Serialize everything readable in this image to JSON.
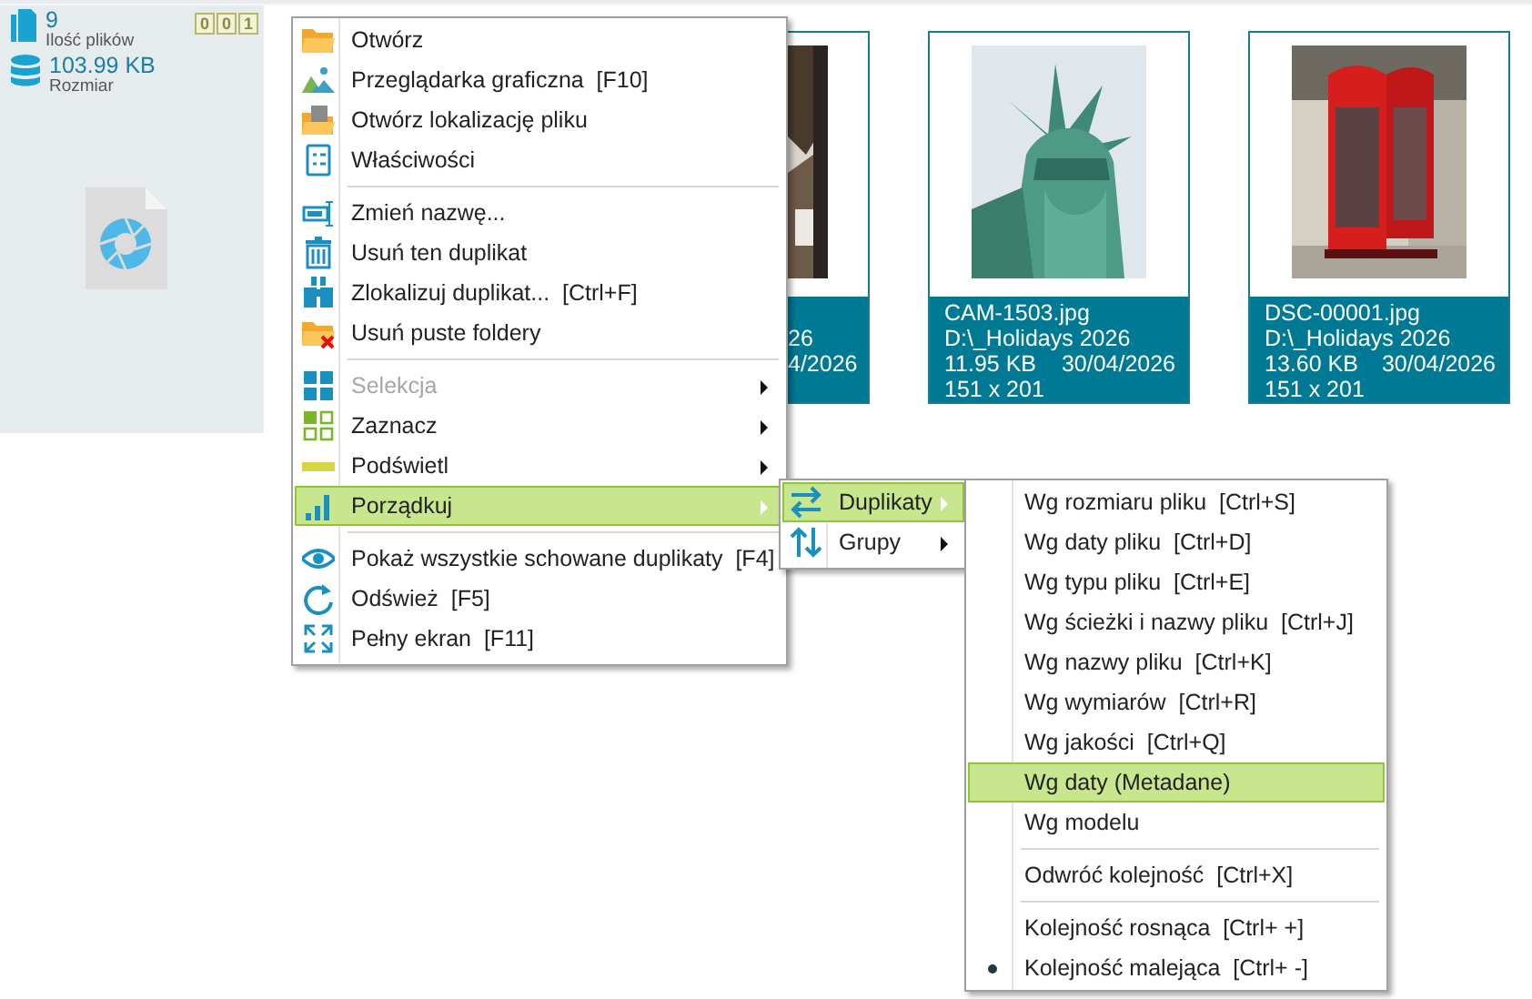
{
  "sidebar": {
    "file_count": "9",
    "file_count_label": "Ilość plików",
    "size": "103.99 KB",
    "size_label": "Rozmiar",
    "counters": [
      "0",
      "0",
      "1"
    ]
  },
  "cards": [
    {
      "kind": "partial",
      "lines": [
        "26",
        "4/2026"
      ]
    },
    {
      "kind": "full",
      "name": "CAM-1503.jpg",
      "path": "D:\\_Holidays 2026",
      "size": "11.95 KB",
      "date": "30/04/2026",
      "dims": "151 x 201"
    },
    {
      "kind": "full",
      "name": "DSC-00001.jpg",
      "path": "D:\\_Holidays 2026",
      "size": "13.60 KB",
      "date": "30/04/2026",
      "dims": "151 x 201"
    }
  ],
  "context_menu": {
    "items": [
      {
        "kind": "item",
        "label": "Otwórz",
        "disabled": false,
        "selected": false,
        "submenu": false
      },
      {
        "kind": "item",
        "label": "Przeglądarka graficzna  [F10]",
        "disabled": false,
        "selected": false,
        "submenu": false
      },
      {
        "kind": "item",
        "label": "Otwórz lokalizację pliku",
        "disabled": false,
        "selected": false,
        "submenu": false
      },
      {
        "kind": "item",
        "label": "Właściwości",
        "disabled": false,
        "selected": false,
        "submenu": false
      },
      {
        "kind": "separator"
      },
      {
        "kind": "item",
        "label": "Zmień nazwę...",
        "disabled": false,
        "selected": false,
        "submenu": false
      },
      {
        "kind": "item",
        "label": "Usuń ten duplikat",
        "disabled": false,
        "selected": false,
        "submenu": false
      },
      {
        "kind": "item",
        "label": "Zlokalizuj duplikat...  [Ctrl+F]",
        "disabled": false,
        "selected": false,
        "submenu": false
      },
      {
        "kind": "item",
        "label": "Usuń puste foldery",
        "disabled": false,
        "selected": false,
        "submenu": false
      },
      {
        "kind": "separator"
      },
      {
        "kind": "item",
        "label": "Selekcja",
        "disabled": true,
        "selected": false,
        "submenu": true
      },
      {
        "kind": "item",
        "label": "Zaznacz",
        "disabled": false,
        "selected": false,
        "submenu": true
      },
      {
        "kind": "item",
        "label": "Podświetl",
        "disabled": false,
        "selected": false,
        "submenu": true
      },
      {
        "kind": "item",
        "label": "Porządkuj",
        "disabled": false,
        "selected": true,
        "submenu": true
      },
      {
        "kind": "separator"
      },
      {
        "kind": "item",
        "label": "Pokaż wszystkie schowane duplikaty  [F4]",
        "disabled": false,
        "selected": false,
        "submenu": false
      },
      {
        "kind": "item",
        "label": "Odśwież  [F5]",
        "disabled": false,
        "selected": false,
        "submenu": false
      },
      {
        "kind": "item",
        "label": "Pełny ekran  [F11]",
        "disabled": false,
        "selected": false,
        "submenu": false
      }
    ]
  },
  "sort_submenu": {
    "items": [
      {
        "label": "Duplikaty",
        "selected": true,
        "submenu": true
      },
      {
        "label": "Grupy",
        "selected": false,
        "submenu": true
      }
    ]
  },
  "duplicates_submenu": {
    "items": [
      {
        "kind": "item",
        "label": "Wg rozmiaru pliku  [Ctrl+S]",
        "selected": false,
        "checked": false
      },
      {
        "kind": "item",
        "label": "Wg daty pliku  [Ctrl+D]",
        "selected": false,
        "checked": false
      },
      {
        "kind": "item",
        "label": "Wg typu pliku  [Ctrl+E]",
        "selected": false,
        "checked": false
      },
      {
        "kind": "item",
        "label": "Wg ścieżki i nazwy pliku  [Ctrl+J]",
        "selected": false,
        "checked": false
      },
      {
        "kind": "item",
        "label": "Wg nazwy pliku  [Ctrl+K]",
        "selected": false,
        "checked": false
      },
      {
        "kind": "item",
        "label": "Wg wymiarów  [Ctrl+R]",
        "selected": false,
        "checked": false
      },
      {
        "kind": "item",
        "label": "Wg jakości  [Ctrl+Q]",
        "selected": false,
        "checked": false
      },
      {
        "kind": "item",
        "label": "Wg daty (Metadane)",
        "selected": true,
        "checked": false
      },
      {
        "kind": "item",
        "label": "Wg modelu",
        "selected": false,
        "checked": false
      },
      {
        "kind": "separator"
      },
      {
        "kind": "item",
        "label": "Odwróć kolejność  [Ctrl+X]",
        "selected": false,
        "checked": false
      },
      {
        "kind": "separator"
      },
      {
        "kind": "item",
        "label": "Kolejność rosnąca  [Ctrl+ +]",
        "selected": false,
        "checked": false
      },
      {
        "kind": "item",
        "label": "Kolejność malejąca  [Ctrl+ -]",
        "selected": false,
        "checked": true
      }
    ]
  }
}
